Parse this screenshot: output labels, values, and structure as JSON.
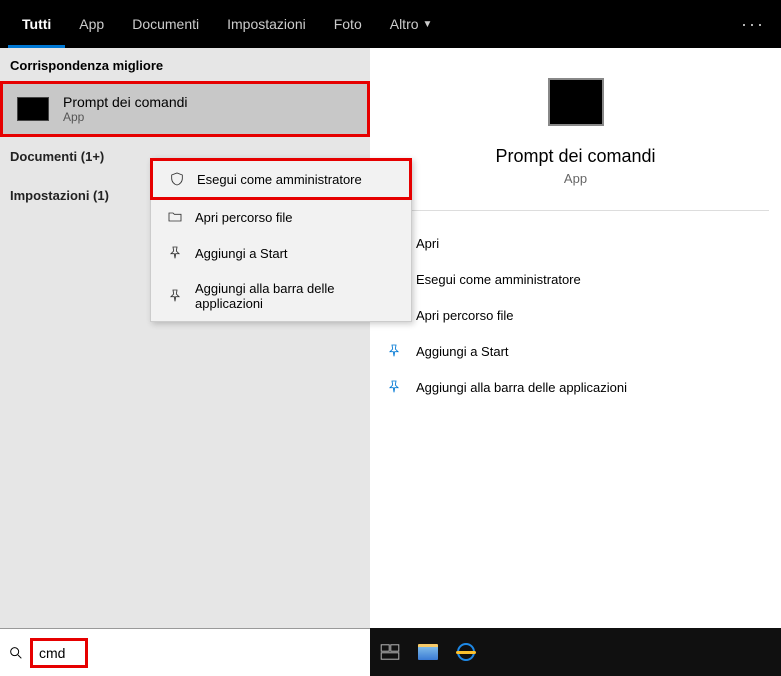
{
  "tabs": {
    "all": "Tutti",
    "app": "App",
    "documents": "Documenti",
    "settings": "Impostazioni",
    "photos": "Foto",
    "more": "Altro"
  },
  "left": {
    "bestMatchLabel": "Corrispondenza migliore",
    "result": {
      "title": "Prompt dei comandi",
      "subtitle": "App"
    },
    "categories": {
      "documents": "Documenti (1+)",
      "settings": "Impostazioni (1)"
    }
  },
  "ctx": {
    "runAdmin": "Esegui come amministratore",
    "openLoc": "Apri percorso file",
    "pinStart": "Aggiungi a Start",
    "pinTaskbar": "Aggiungi alla barra delle applicazioni"
  },
  "preview": {
    "title": "Prompt dei comandi",
    "subtitle": "App"
  },
  "actions": {
    "open": "Apri",
    "runAdmin": "Esegui come amministratore",
    "openLoc": "Apri percorso file",
    "pinStart": "Aggiungi a Start",
    "pinTaskbar": "Aggiungi alla barra delle applicazioni"
  },
  "search": {
    "value": "cmd"
  }
}
